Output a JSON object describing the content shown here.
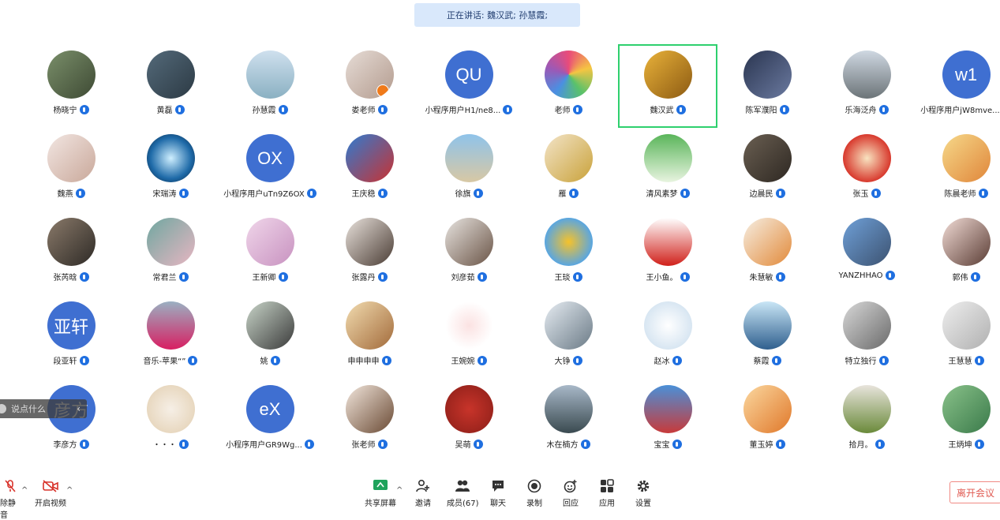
{
  "speaking_banner": "正在讲话: 魏汉武; 孙慧霞;",
  "hint_text": "说点什么",
  "participants": [
    {
      "name": "杨晓宁",
      "bg": "linear-gradient(135deg,#7a8f6a,#3e4a34)"
    },
    {
      "name": "黄磊",
      "bg": "linear-gradient(135deg,#546a7a,#2c3a44)"
    },
    {
      "name": "孙慧霞",
      "bg": "linear-gradient(180deg,#cfe0ee,#8ab0c2)"
    },
    {
      "name": "娄老师",
      "bg": "linear-gradient(135deg,#e6dcd6,#b39b8e)"
    },
    {
      "name": "小程序用户H1/ne8...",
      "initials": "QU"
    },
    {
      "name": "老师",
      "bg": "conic-gradient(#e94b7a,#f5c542,#5ac26a,#4a90e2,#9b59b6,#e94b7a)"
    },
    {
      "name": "魏汉武",
      "bg": "linear-gradient(135deg,#e9b23a,#8c5a12)",
      "active": true
    },
    {
      "name": "陈军濮阳",
      "bg": "linear-gradient(135deg,#2a3550,#6b7aa0)"
    },
    {
      "name": "乐海泛舟",
      "bg": "linear-gradient(180deg,#cfd8e2,#6c7478)"
    },
    {
      "name": "小程序用户jW8mve...",
      "initials": "w1"
    },
    {
      "name": "魏燕",
      "bg": "linear-gradient(135deg,#f2e6e2,#c9a89a)"
    },
    {
      "name": "宋瑞涛",
      "bg": "radial-gradient(circle,#cfefff,#1e6aa8 60%,#0a1f38)"
    },
    {
      "name": "小程序用户uTn9Z6OX",
      "initials": "OX"
    },
    {
      "name": "王庆稳",
      "bg": "linear-gradient(135deg,#2f7bd0,#c93232)"
    },
    {
      "name": "徐旗",
      "bg": "linear-gradient(180deg,#8fc3ea,#d8c8a4)"
    },
    {
      "name": "雁",
      "bg": "linear-gradient(135deg,#f3e4c8,#c9a23a)"
    },
    {
      "name": "清风素梦",
      "bg": "linear-gradient(180deg,#5ab55a,#e8f4e0)"
    },
    {
      "name": "边晨民",
      "bg": "linear-gradient(135deg,#6a5f52,#2e2822)"
    },
    {
      "name": "张玉",
      "bg": "radial-gradient(circle,#f8e3c0,#d83a2e 70%)"
    },
    {
      "name": "陈晨老师",
      "bg": "linear-gradient(135deg,#f6d98a,#e0863a)"
    },
    {
      "name": "张芮晗",
      "bg": "linear-gradient(135deg,#8a7a6a,#2e2a26)"
    },
    {
      "name": "常君兰",
      "bg": "linear-gradient(135deg,#6fa7a0,#e8b6c2)"
    },
    {
      "name": "王新卿",
      "bg": "linear-gradient(135deg,#f0d6ea,#c892c0)"
    },
    {
      "name": "张露丹",
      "bg": "linear-gradient(135deg,#e9e2dc,#4a3c34)"
    },
    {
      "name": "刘彦茹",
      "bg": "linear-gradient(135deg,#e8e4e0,#6a5446)"
    },
    {
      "name": "王琰",
      "bg": "radial-gradient(circle,#f6c22a,#5aa6e0 70%)"
    },
    {
      "name": "王小鱼。",
      "bg": "linear-gradient(180deg,#ffffff,#d0201a)"
    },
    {
      "name": "朱慧敏",
      "bg": "linear-gradient(135deg,#f6eee2,#e28a3a)"
    },
    {
      "name": "YANZHHAO",
      "bg": "linear-gradient(135deg,#6fa0d8,#3c5270)"
    },
    {
      "name": "郭伟",
      "bg": "linear-gradient(135deg,#f2dcd6,#5a3c34)"
    },
    {
      "name": "段亚轩",
      "initials": "亚轩"
    },
    {
      "name": "音乐-苹果“”",
      "bg": "linear-gradient(180deg,#9ab0c2,#d81f62)"
    },
    {
      "name": "姚",
      "bg": "linear-gradient(135deg,#c8d4c8,#3a3a3a)"
    },
    {
      "name": "申申申申",
      "bg": "linear-gradient(135deg,#f2dcb0,#a26a3a)"
    },
    {
      "name": "王婉婉",
      "bg": "radial-gradient(circle,#fbe2e2,#ffffff 70%)"
    },
    {
      "name": "大铮",
      "bg": "linear-gradient(135deg,#e6ecf2,#6a7a86)"
    },
    {
      "name": "赵冰",
      "bg": "radial-gradient(circle,#ffffff,#d8e6f2 70%)"
    },
    {
      "name": "蔡霞",
      "bg": "linear-gradient(180deg,#c9e6f6,#2f5f8e)"
    },
    {
      "name": "特立独行",
      "bg": "linear-gradient(135deg,#d8d8d8,#6a6a6a)"
    },
    {
      "name": "王慧慧",
      "bg": "linear-gradient(135deg,#eeeeee,#b0b0b0)"
    },
    {
      "name": "李彦方",
      "initials": "彦方"
    },
    {
      "name": "・・・",
      "bg": "radial-gradient(circle,#f6efe6,#e8d8c0 70%)"
    },
    {
      "name": "小程序用户GR9Wg...",
      "initials": "eX"
    },
    {
      "name": "张老师",
      "bg": "linear-gradient(135deg,#f2e6dc,#6a4a34)"
    },
    {
      "name": "吴萌",
      "bg": "radial-gradient(circle,#c8342a,#8a1e18)"
    },
    {
      "name": "木在楠方",
      "bg": "linear-gradient(180deg,#a8b8c8,#3a4a50)"
    },
    {
      "name": "宝宝",
      "bg": "linear-gradient(180deg,#4a90d8,#c83a3a)"
    },
    {
      "name": "董玉婷",
      "bg": "linear-gradient(135deg,#fbd8a0,#e0782a)"
    },
    {
      "name": "拾月。",
      "bg": "linear-gradient(180deg,#e8e4dc,#6a8a3a)"
    },
    {
      "name": "王炳坤",
      "bg": "linear-gradient(135deg,#8ac28a,#3a7a4a)"
    }
  ],
  "toolbar": {
    "mute": "除静音",
    "video": "开启视频",
    "share": "共享屏幕",
    "invite": "邀请",
    "members": "成员(67)",
    "chat": "聊天",
    "record": "录制",
    "reaction": "回应",
    "apps": "应用",
    "settings": "设置",
    "leave": "离开会议"
  },
  "colors": {
    "accent": "#1f6fe0",
    "active_border": "#2ed06e",
    "leave": "#e05a52",
    "share": "#1fa35c"
  }
}
